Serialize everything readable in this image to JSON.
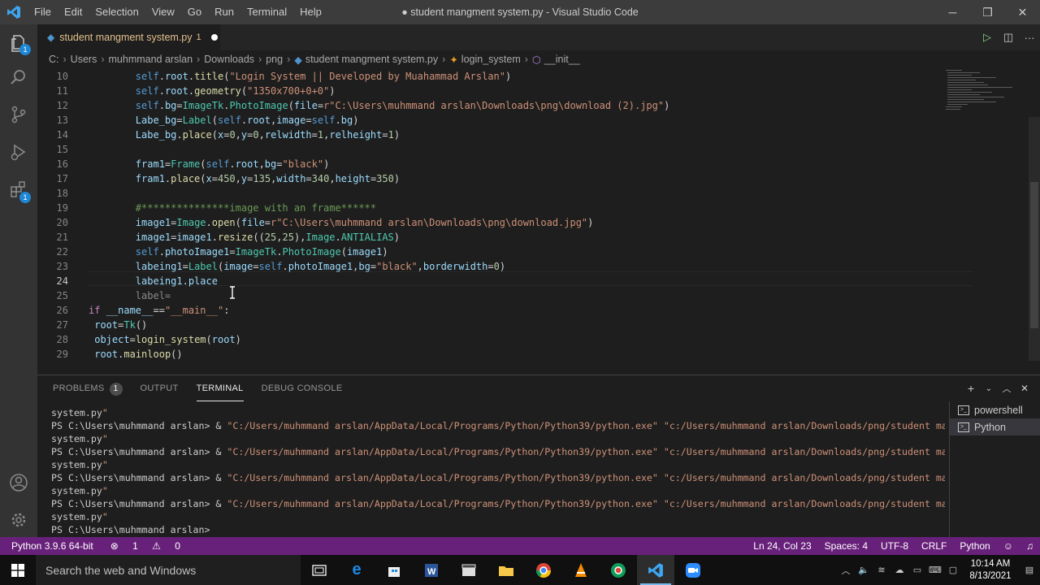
{
  "window": {
    "title": "● student mangment system.py - Visual Studio Code",
    "menu": [
      "File",
      "Edit",
      "Selection",
      "View",
      "Go",
      "Run",
      "Terminal",
      "Help"
    ]
  },
  "tab": {
    "name": "student mangment system.py",
    "problems": "1"
  },
  "activity_badges": {
    "explorer": "1",
    "extensions": "1"
  },
  "breadcrumb": [
    "C:",
    "Users",
    "muhmmand arslan",
    "Downloads",
    "png",
    "student mangment system.py",
    "login_system",
    "__init__"
  ],
  "editor": {
    "line_numbers": [
      "10",
      "11",
      "12",
      "13",
      "14",
      "15",
      "16",
      "17",
      "18",
      "19",
      "20",
      "21",
      "22",
      "23",
      "24",
      "25",
      "26",
      "27",
      "28",
      "29"
    ],
    "current_line": "24",
    "lines": [
      "        self.root.title(\"Login System || Developed by Muahammad Arslan\")",
      "        self.root.geometry(\"1350x700+0+0\")",
      "        self.bg=ImageTk.PhotoImage(file=r\"C:\\Users\\muhmmand arslan\\Downloads\\png\\download (2).jpg\")",
      "        Labe_bg=Label(self.root,image=self.bg)",
      "        Labe_bg.place(x=0,y=0,relwidth=1,relheight=1)",
      "",
      "        fram1=Frame(self.root,bg=\"black\")",
      "        fram1.place(x=450,y=135,width=340,height=350)",
      "",
      "        #***************image with an frame******",
      "        image1=Image.open(file=r\"C:\\Users\\muhmmand arslan\\Downloads\\png\\download.jpg\")",
      "        image1=image1.resize((25,25),Image.ANTIALIAS)",
      "        self.photoImage1=ImageTk.PhotoImage(image1)",
      "        labeing1=Label(image=self.photoImage1,bg=\"black\",borderwidth=0)",
      "        labeing1.place",
      "        label=",
      "if __name__==\"__main__\":",
      " root=Tk()",
      " object=login_system(root)",
      " root.mainloop()"
    ]
  },
  "panel": {
    "tabs": [
      "PROBLEMS",
      "OUTPUT",
      "TERMINAL",
      "DEBUG CONSOLE"
    ],
    "problems_count": "1",
    "active_tab": "TERMINAL",
    "terminal_lines": [
      "system.py\"",
      "PS C:\\Users\\muhmmand arslan> & \"C:/Users/muhmmand arslan/AppData/Local/Programs/Python/Python39/python.exe\" \"c:/Users/muhmmand arslan/Downloads/png/student mangment",
      "system.py\"",
      "PS C:\\Users\\muhmmand arslan> & \"C:/Users/muhmmand arslan/AppData/Local/Programs/Python/Python39/python.exe\" \"c:/Users/muhmmand arslan/Downloads/png/student mangment",
      "system.py\"",
      "PS C:\\Users\\muhmmand arslan> & \"C:/Users/muhmmand arslan/AppData/Local/Programs/Python/Python39/python.exe\" \"c:/Users/muhmmand arslan/Downloads/png/student mangment",
      "system.py\"",
      "PS C:\\Users\\muhmmand arslan> & \"C:/Users/muhmmand arslan/AppData/Local/Programs/Python/Python39/python.exe\" \"c:/Users/muhmmand arslan/Downloads/png/student mangment",
      "system.py\"",
      "PS C:\\Users\\muhmmand arslan>"
    ],
    "terminals": [
      "powershell",
      "Python"
    ]
  },
  "status": {
    "interpreter": "Python 3.9.6 64-bit",
    "errors": "1",
    "warnings": "0",
    "cursor": "Ln 24, Col 23",
    "spaces": "Spaces: 4",
    "encoding": "UTF-8",
    "eol": "CRLF",
    "language": "Python"
  },
  "taskbar": {
    "search_placeholder": "Search the web and Windows",
    "time": "10:14 AM",
    "date": "8/13/2021"
  },
  "colors": {
    "status_bar": "#68217a",
    "accent": "#007acc"
  }
}
